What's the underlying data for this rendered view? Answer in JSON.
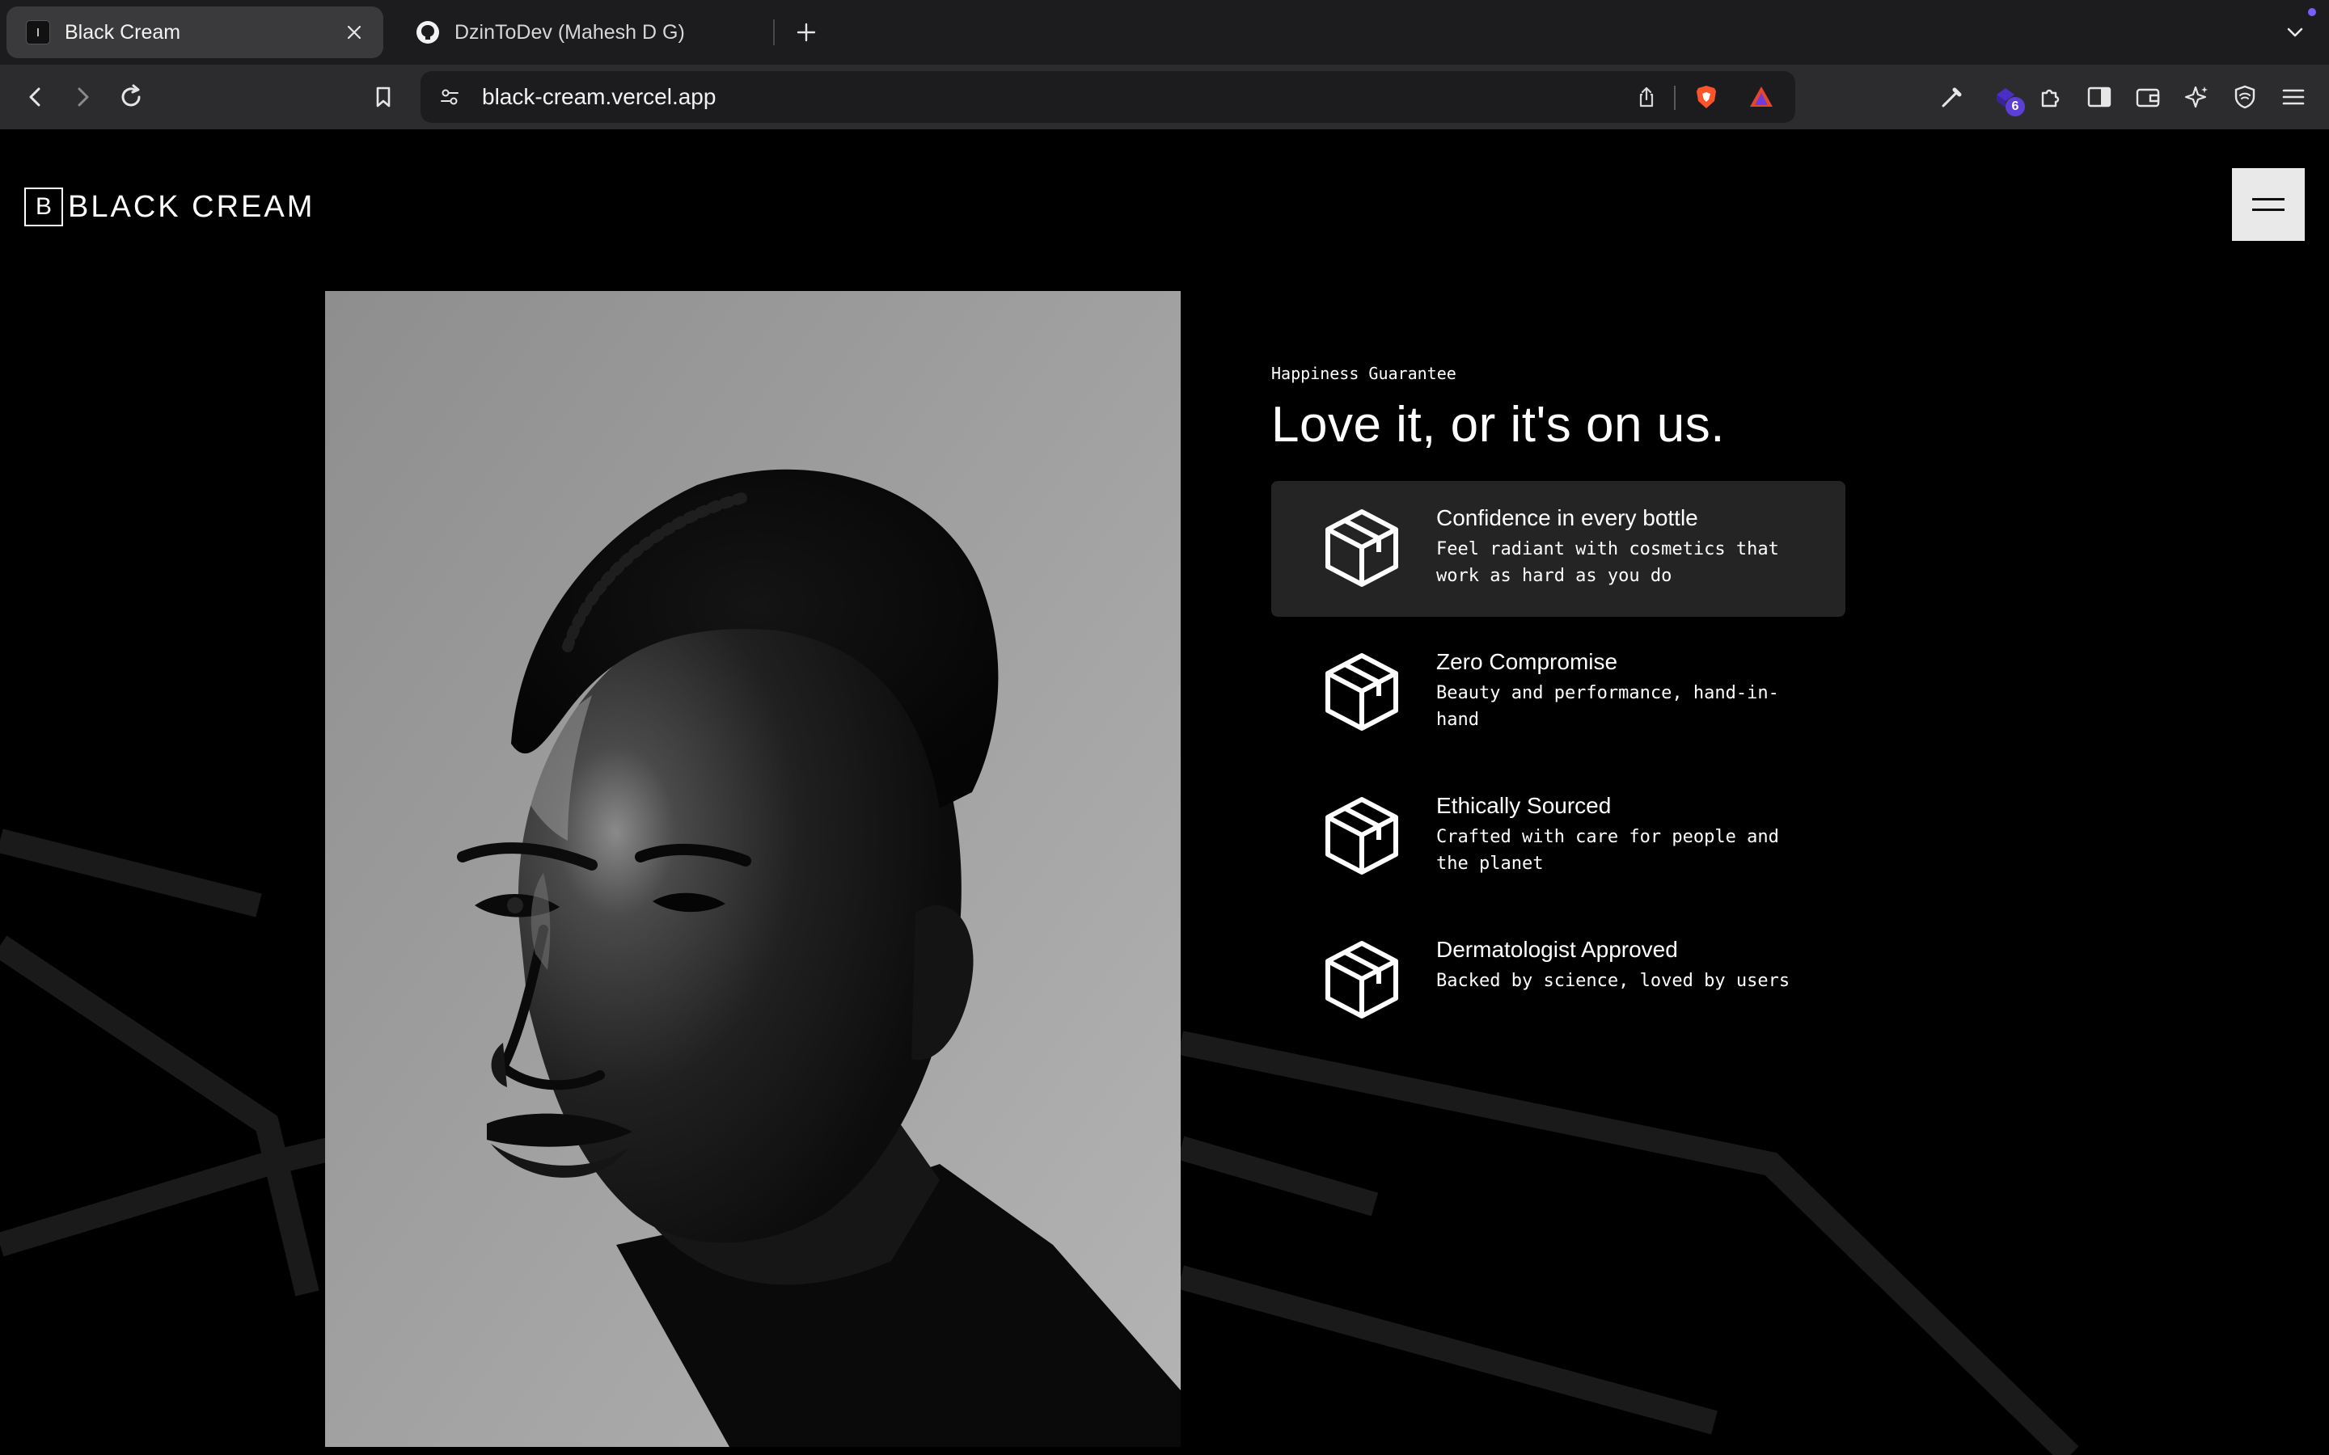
{
  "browser": {
    "tabs": [
      {
        "title": "Black Cream",
        "active": true,
        "icon": "black-cream-favicon"
      },
      {
        "title": "DzinToDev (Mahesh D G)",
        "active": false,
        "icon": "github-icon"
      }
    ],
    "url": "black-cream.vercel.app",
    "extension_badge": "6"
  },
  "site": {
    "logo_mark": "B",
    "logo_text": "BLACK CREAM",
    "eyebrow": "Happiness Guarantee",
    "headline": "Love it, or it's on us.",
    "features": [
      {
        "title": "Confidence in every bottle",
        "desc": "Feel radiant with cosmetics that work as hard as you do",
        "icon": "box-icon",
        "active": true
      },
      {
        "title": "Zero Compromise",
        "desc": "Beauty and performance, hand-in-hand",
        "icon": "box-icon",
        "active": false
      },
      {
        "title": "Ethically Sourced",
        "desc": "Crafted with care for people and the planet",
        "icon": "box-icon",
        "active": false
      },
      {
        "title": "Dermatologist Approved",
        "desc": "Backed by science, loved by users",
        "icon": "box-icon",
        "active": false
      }
    ]
  },
  "colors": {
    "page_bg": "#000000",
    "active_card_bg": "#242424",
    "menu_button_bg": "#e9e9ea",
    "tabbar_bg": "#1c1c1e",
    "toolbar_bg": "#2c2c2e"
  }
}
